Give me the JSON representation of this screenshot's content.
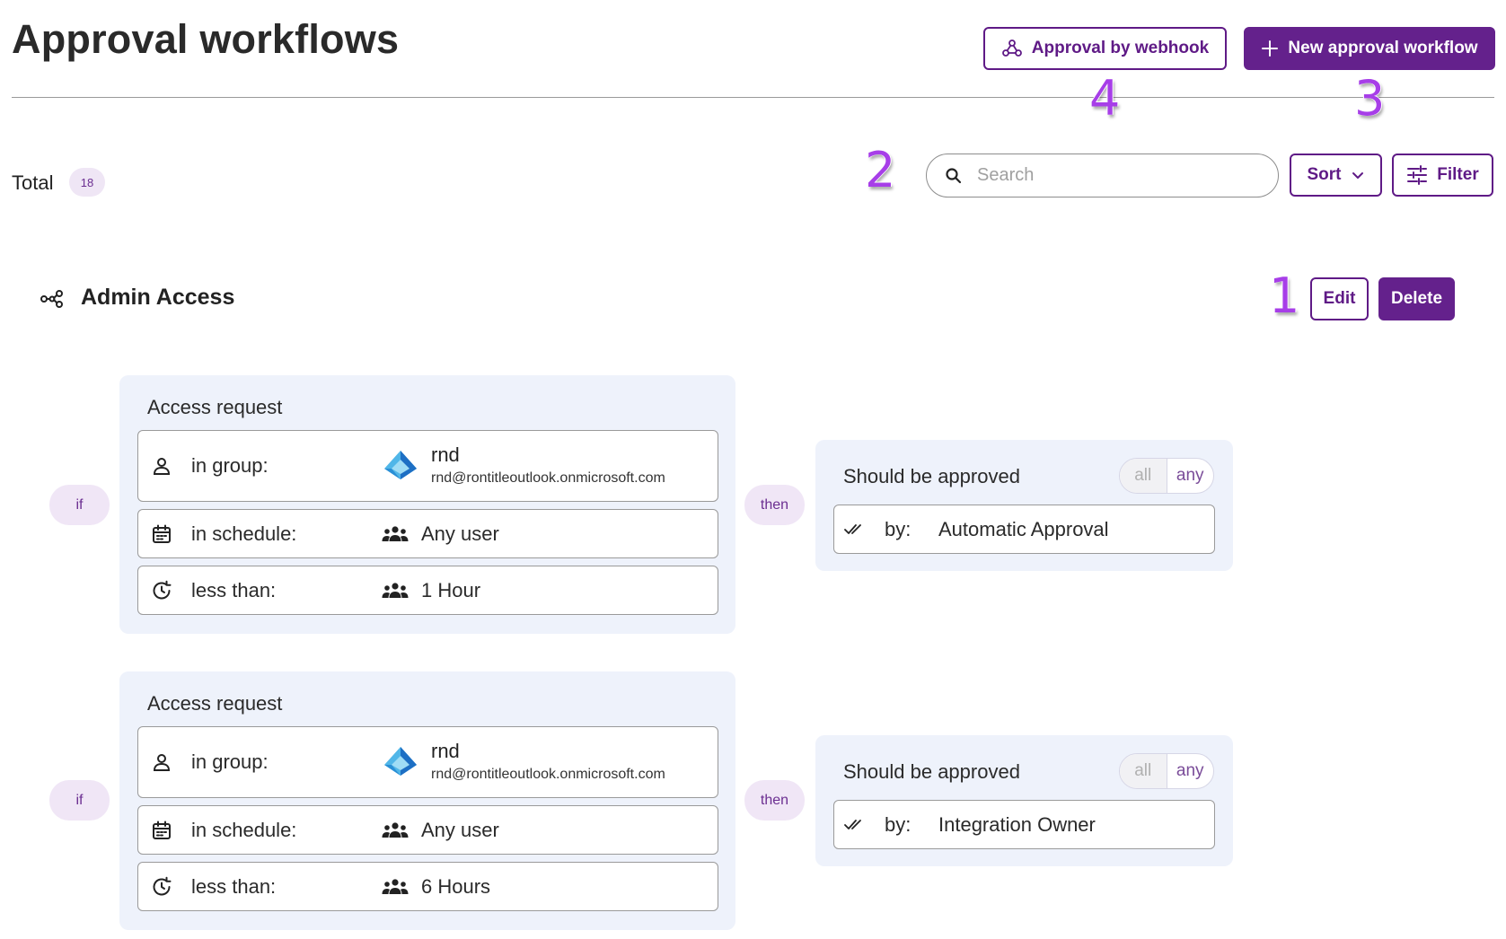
{
  "header": {
    "title": "Approval workflows",
    "webhook_button": "Approval by webhook",
    "new_button": "New approval workflow"
  },
  "markers": [
    "1",
    "2",
    "3",
    "4"
  ],
  "toolbar": {
    "total_label": "Total",
    "total_count": "18",
    "search_placeholder": "Search",
    "sort_label": "Sort",
    "filter_label": "Filter"
  },
  "workflow": {
    "name": "Admin Access",
    "edit_label": "Edit",
    "delete_label": "Delete",
    "rules": [
      {
        "if_label": "if",
        "then_label": "then",
        "condition": {
          "title": "Access request",
          "group_label": "in group:",
          "group_name": "rnd",
          "group_email": "rnd@rontitleoutlook.onmicrosoft.com",
          "schedule_label": "in schedule:",
          "schedule_value": "Any user",
          "duration_label": "less than:",
          "duration_value": "1 Hour"
        },
        "approval": {
          "title": "Should be approved",
          "toggle_all": "all",
          "toggle_any": "any",
          "by_label": "by:",
          "by_value": "Automatic Approval"
        }
      },
      {
        "if_label": "if",
        "then_label": "then",
        "condition": {
          "title": "Access request",
          "group_label": "in group:",
          "group_name": "rnd",
          "group_email": "rnd@rontitleoutlook.onmicrosoft.com",
          "schedule_label": "in schedule:",
          "schedule_value": "Any user",
          "duration_label": "less than:",
          "duration_value": "6 Hours"
        },
        "approval": {
          "title": "Should be approved",
          "toggle_all": "all",
          "toggle_any": "any",
          "by_label": "by:",
          "by_value": "Integration Owner"
        }
      }
    ]
  },
  "icons": {
    "webhook": "webhook-icon",
    "plus": "plus-icon",
    "search": "search-icon",
    "sort": "chevron-down-icon",
    "filter": "sliders-icon",
    "workflow": "workflow-icon",
    "user": "user-icon",
    "calendar": "calendar-icon",
    "clock": "clock-history-icon",
    "group": "group-users-icon",
    "azure": "azure-ad-icon",
    "check": "double-check-icon"
  },
  "colors": {
    "brand": "#64218c",
    "marker": "#a73ee8",
    "card_bg": "#eef2fb",
    "pill_bg": "#f0e6f6"
  }
}
